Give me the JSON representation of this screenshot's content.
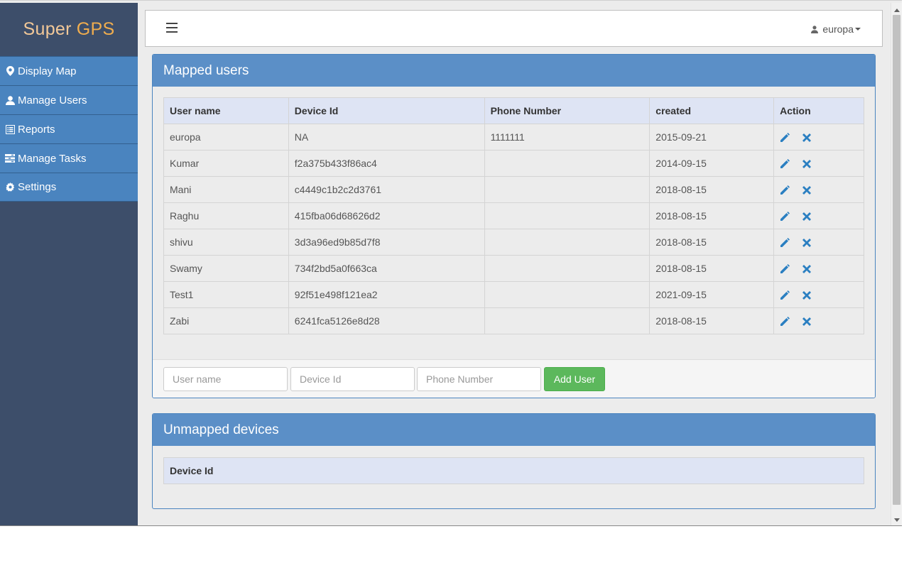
{
  "brand": {
    "part1": "Super",
    "part2": "GPS"
  },
  "sidebar": {
    "items": [
      {
        "label": "Display Map",
        "icon": "map-marker-icon"
      },
      {
        "label": "Manage Users",
        "icon": "user-icon"
      },
      {
        "label": "Reports",
        "icon": "list-alt-icon"
      },
      {
        "label": "Manage Tasks",
        "icon": "tasks-icon"
      },
      {
        "label": "Settings",
        "icon": "gear-icon"
      }
    ]
  },
  "topbar": {
    "user": "europa"
  },
  "mapped": {
    "title": "Mapped users",
    "headers": [
      "User name",
      "Device Id",
      "Phone Number",
      "created",
      "Action"
    ],
    "rows": [
      [
        "europa",
        "NA",
        "1111111",
        "2015-09-21"
      ],
      [
        "Kumar",
        "f2a375b433f86ac4",
        "",
        "2014-09-15"
      ],
      [
        "Mani",
        "c4449c1b2c2d3761",
        "",
        "2018-08-15"
      ],
      [
        "Raghu",
        "415fba06d68626d2",
        "",
        "2018-08-15"
      ],
      [
        "shivu",
        "3d3a96ed9b85d7f8",
        "",
        "2018-08-15"
      ],
      [
        "Swamy",
        "734f2bd5a0f663ca",
        "",
        "2018-08-15"
      ],
      [
        "Test1",
        "92f51e498f121ea2",
        "",
        "2021-09-15"
      ],
      [
        "Zabi",
        "6241fca5126e8d28",
        "",
        "2018-08-15"
      ]
    ],
    "form": {
      "username_placeholder": "User name",
      "deviceid_placeholder": "Device Id",
      "phone_placeholder": "Phone Number",
      "add_label": "Add User"
    }
  },
  "unmapped": {
    "title": "Unmapped devices",
    "headers": [
      "Device Id"
    ]
  },
  "colors": {
    "sidebar_bg": "#3d4e6a",
    "nav_bg": "#4a84bf",
    "panel_head": "#5b8fc7",
    "success": "#5cb85c",
    "action_icon": "#2a7fc1",
    "brand_accent": "#f0ad4e"
  }
}
